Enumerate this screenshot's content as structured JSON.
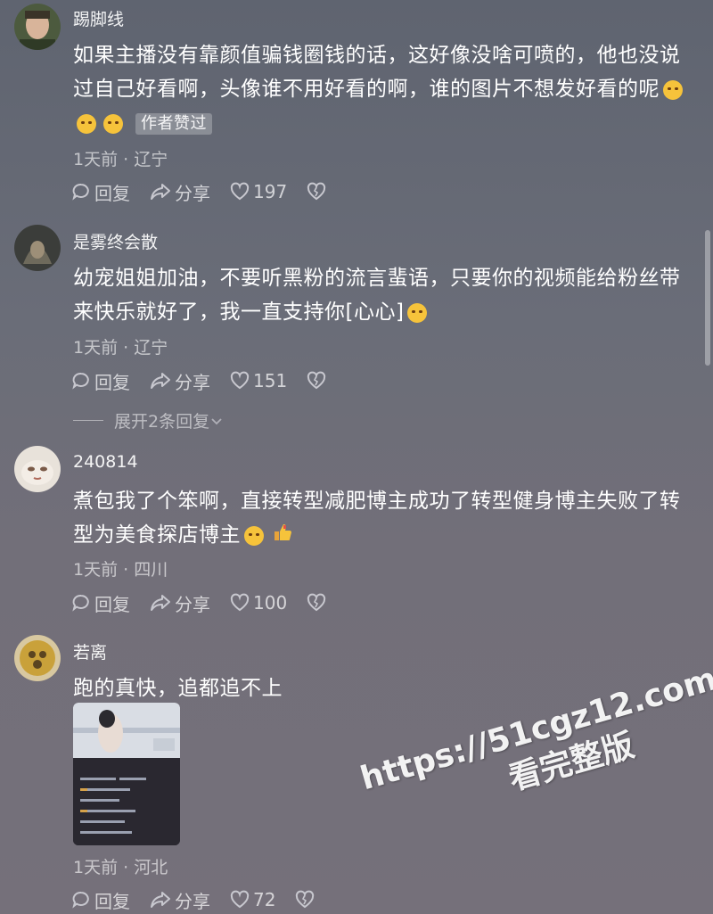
{
  "comments": [
    {
      "username": "踢脚线",
      "text": "如果主播没有靠颜值骗钱圈钱的话，这好像没啥可喷的，他也没说过自己好看啊，头像谁不用好看的啊，谁的图片不想发好看的呢",
      "emojis": [
        "laugh-cry-emoji",
        "laugh-cry-emoji",
        "laugh-cry-emoji"
      ],
      "badge": "作者赞过",
      "meta": "1天前 · 辽宁",
      "reply": "回复",
      "share": "分享",
      "likes": "197"
    },
    {
      "username": "是雾终会散",
      "text": "幼宠姐姐加油，不要听黑粉的流言蜚语，只要你的视频能给粉丝带来快乐就好了，我一直支持你[心心]",
      "emojis": [
        "smile-emoji"
      ],
      "meta": "1天前 · 辽宁",
      "reply": "回复",
      "share": "分享",
      "likes": "151",
      "expand": "展开2条回复"
    },
    {
      "username": "240814",
      "text": "煮包我了个笨啊，直接转型减肥博主成功了转型健身博主失败了转型为美食探店博主",
      "emojis": [
        "grimace-emoji",
        "thumbs-up-emoji"
      ],
      "meta": "1天前 · 四川",
      "reply": "回复",
      "share": "分享",
      "likes": "100"
    },
    {
      "username": "若离",
      "text": "跑的真快，追都追不上",
      "meta": "1天前 · 河北",
      "reply": "回复",
      "share": "分享",
      "likes": "72"
    }
  ],
  "watermark": {
    "url": "https://51cgz12.com",
    "sub": "看完整版"
  },
  "colors": {
    "background": "#6a6d78",
    "meta": "#b8b8c0"
  }
}
